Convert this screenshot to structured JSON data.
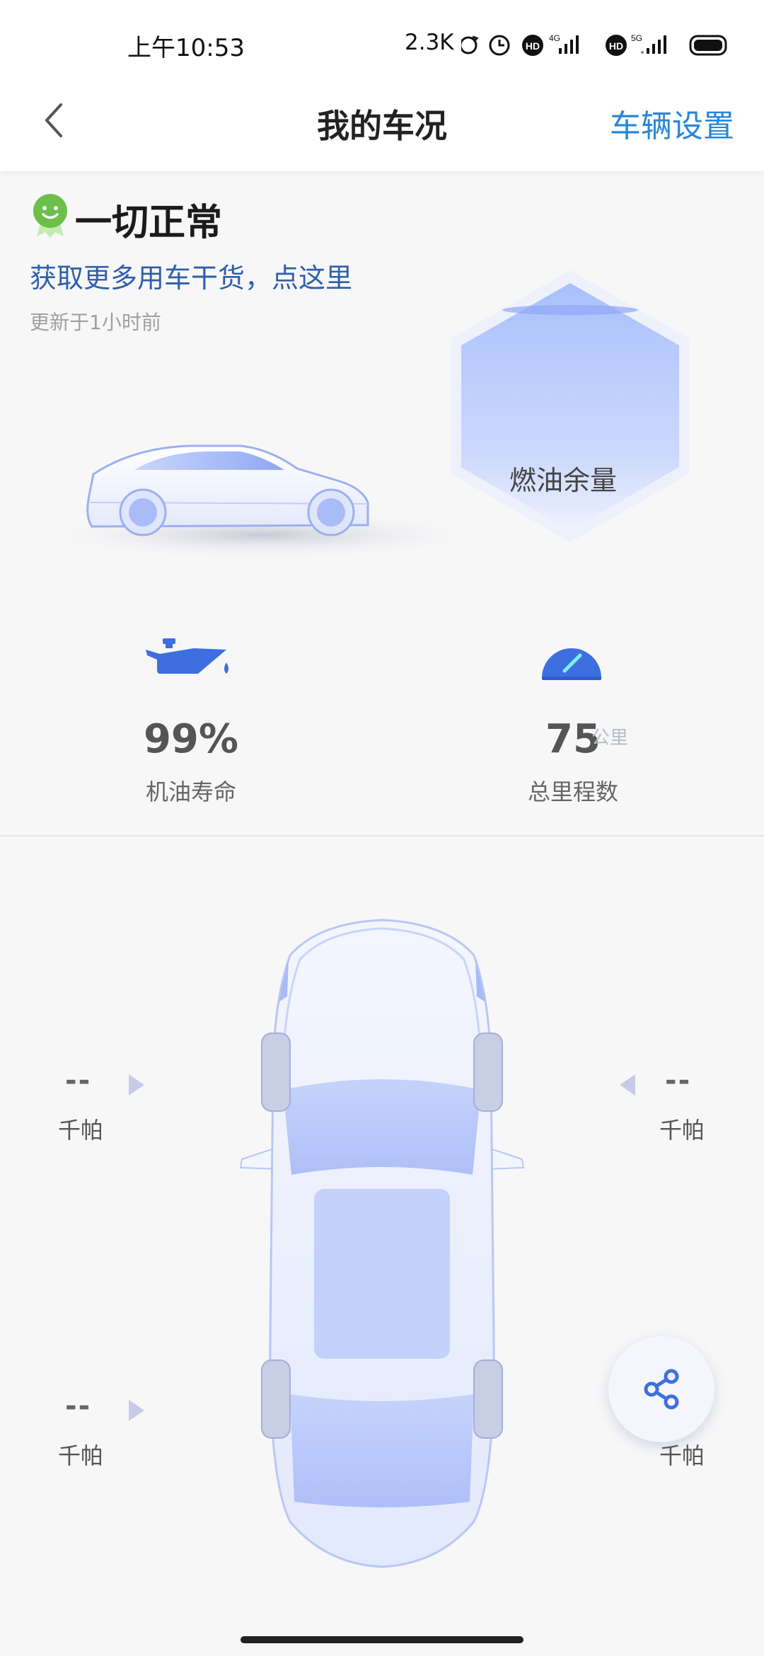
{
  "status_bar": {
    "time": "上午10:53",
    "net_speed": "2.3K",
    "icons": [
      "sync-icon",
      "alarm-icon",
      "hd-icon",
      "signal-4g-icon",
      "hd-icon",
      "signal-5g-icon",
      "battery-icon"
    ]
  },
  "header": {
    "title": "我的车况",
    "settings_link": "车辆设置",
    "back_icon": "chevron-left-icon"
  },
  "vehicle_status": {
    "summary": "一切正常",
    "tips_link": "获取更多用车干货，点这里",
    "updated": "更新于1小时前"
  },
  "fuel": {
    "label": "燃油余量"
  },
  "stats": {
    "oil_life": {
      "value": "99%",
      "label": "机油寿命"
    },
    "mileage": {
      "value": "75",
      "unit": "公里",
      "label": "总里程数"
    }
  },
  "tires": {
    "front_left": {
      "value": "--",
      "unit": "千帕"
    },
    "front_right": {
      "value": "--",
      "unit": "千帕"
    },
    "rear_left": {
      "value": "--",
      "unit": "千帕"
    },
    "rear_right": {
      "unit": "千帕"
    }
  },
  "colors": {
    "accent": "#2a86d6",
    "link": "#2f5fa9",
    "ok_green": "#6cc04a",
    "car_blue": "#b8c8fb"
  }
}
